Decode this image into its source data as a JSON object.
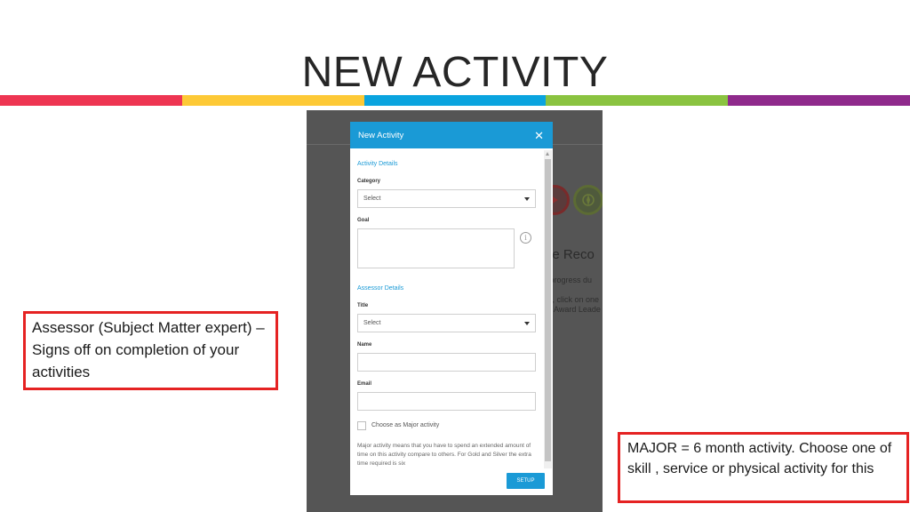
{
  "slide": {
    "title": "NEW ACTIVITY",
    "colors": [
      "#ee3552",
      "#fdc936",
      "#0aa4df",
      "#8ac340",
      "#8f2a8c"
    ]
  },
  "background_app": {
    "heading_fragment": "ne Reco",
    "text_line1": "r progress du",
    "text_line2": "t, click on one",
    "text_line3": "Award Leade",
    "icons": [
      "red-badge-icon",
      "green-compass-icon"
    ]
  },
  "modal": {
    "title": "New Activity",
    "close_glyph": "✕",
    "activity_section": "Activity Details",
    "category_label": "Category",
    "category_value": "Select",
    "goal_label": "Goal",
    "info_glyph": "i",
    "assessor_section": "Assessor Details",
    "title_label": "Title",
    "title_value": "Select",
    "name_label": "Name",
    "email_label": "Email",
    "major_checkbox_label": "Choose as Major activity",
    "major_note": "Major activity means that you have to spend an extended amount of time on this activity compare to others. For Gold and Silver the extra time required is six",
    "setup_label": "SETUP"
  },
  "callouts": {
    "assessor": "Assessor (Subject Matter expert) – Signs off on completion of your activities",
    "major": "MAJOR = 6 month activity. Choose one of skill , service or physical activity for this"
  }
}
